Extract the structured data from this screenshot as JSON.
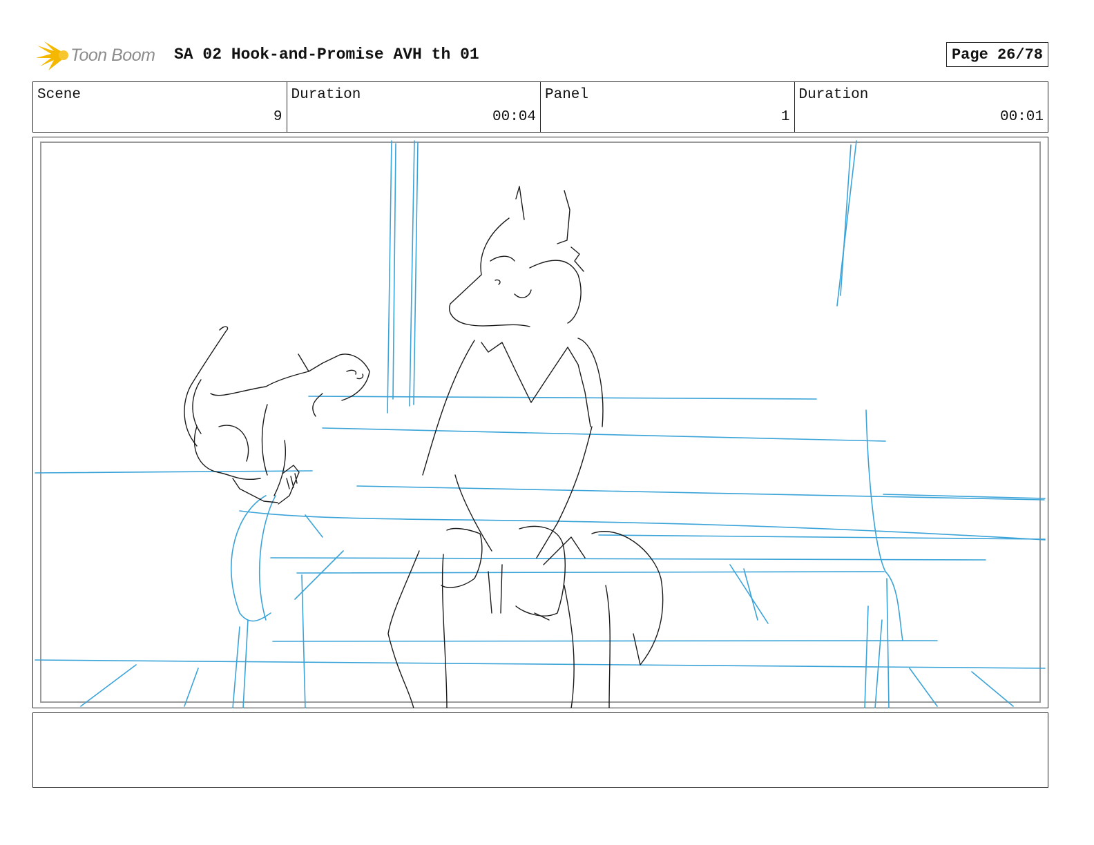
{
  "header": {
    "logo_text": "Toon Boom",
    "title": "SA 02 Hook-and-Promise AVH th 01",
    "page": "Page 26/78"
  },
  "info": {
    "scene_label": "Scene",
    "scene_value": "9",
    "scene_duration_label": "Duration",
    "scene_duration_value": "00:04",
    "panel_label": "Panel",
    "panel_value": "1",
    "panel_duration_label": "Duration",
    "panel_duration_value": "00:01"
  },
  "notes": {
    "text": ""
  },
  "colors": {
    "sketch_blue": "#3aa3d8",
    "sketch_black": "#1a1a1a",
    "logo_yellow": "#f5b800",
    "safe_frame": "#9a9a9a"
  },
  "icons": {
    "logo": "toon-boom-starburst-icon"
  }
}
